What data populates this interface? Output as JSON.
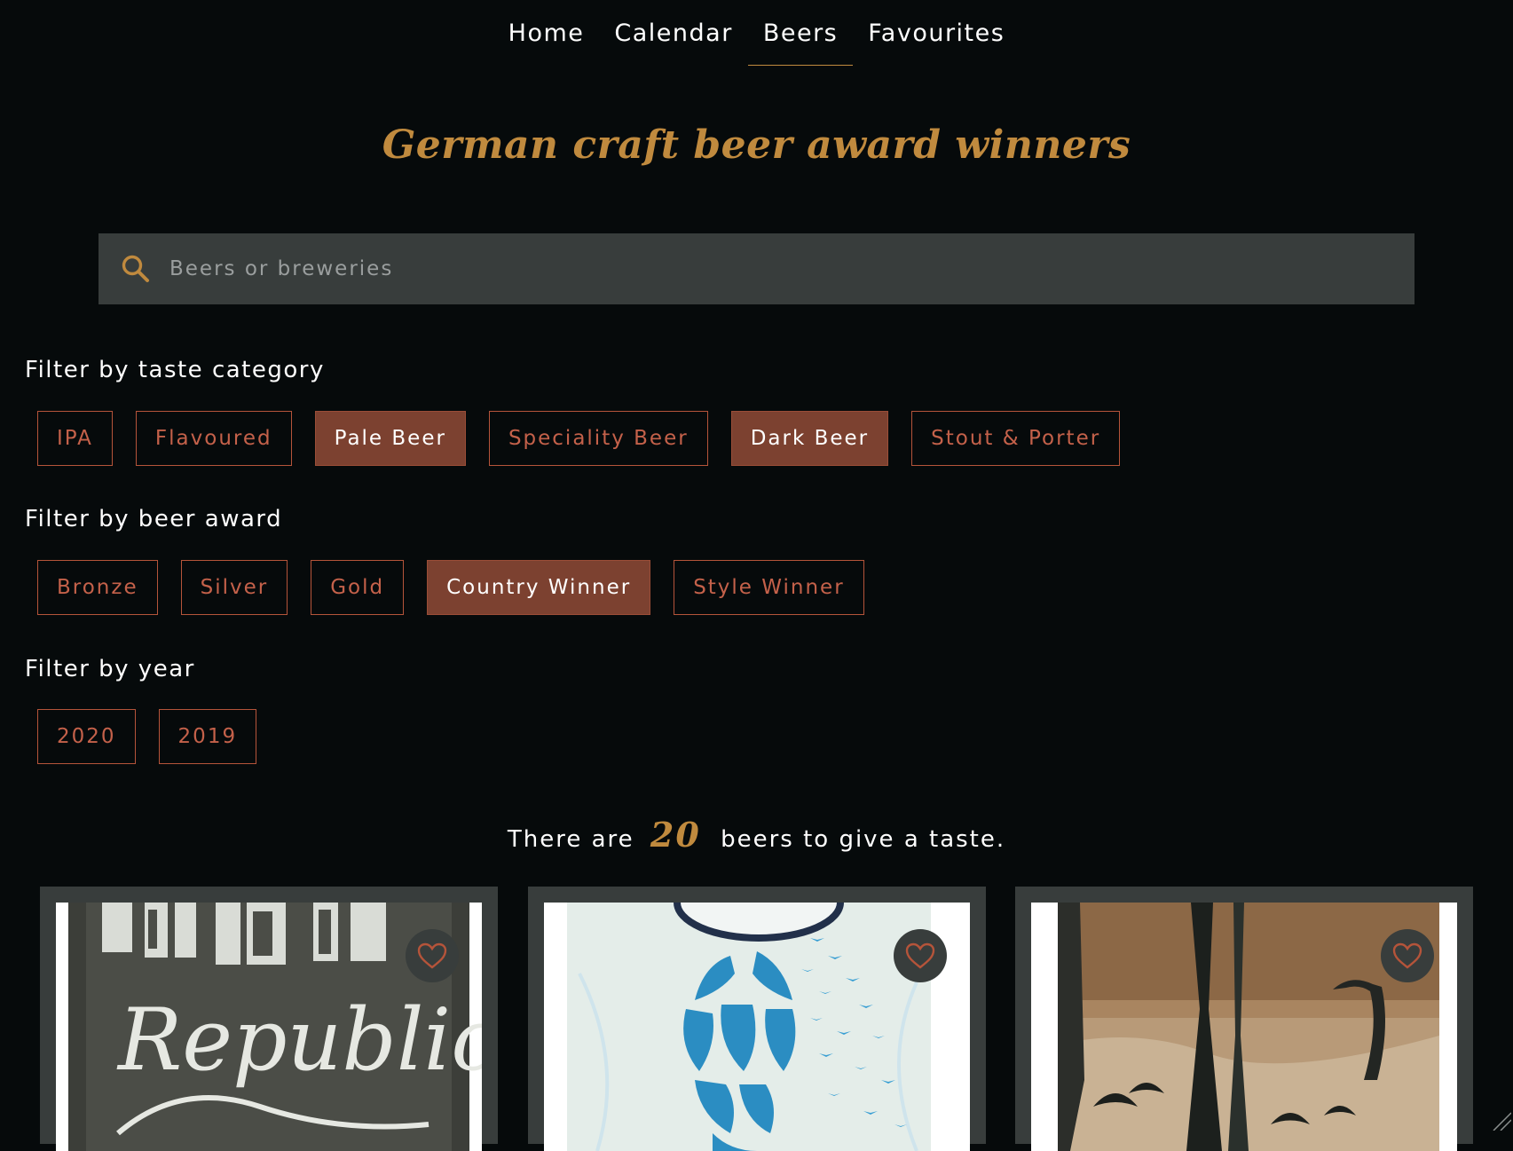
{
  "nav": {
    "items": [
      {
        "label": "Home"
      },
      {
        "label": "Calendar"
      },
      {
        "label": "Beers"
      },
      {
        "label": "Favourites"
      }
    ],
    "active": "Beers"
  },
  "page_title": "German craft beer award winners",
  "search": {
    "placeholder": "Beers or breweries",
    "value": ""
  },
  "filters": {
    "taste": {
      "heading": "Filter by taste category",
      "options": [
        {
          "label": "IPA",
          "selected": false
        },
        {
          "label": "Flavoured",
          "selected": false
        },
        {
          "label": "Pale Beer",
          "selected": true
        },
        {
          "label": "Speciality Beer",
          "selected": false
        },
        {
          "label": "Dark Beer",
          "selected": true
        },
        {
          "label": "Stout & Porter",
          "selected": false
        }
      ]
    },
    "award": {
      "heading": "Filter by beer award",
      "options": [
        {
          "label": "Bronze",
          "selected": false
        },
        {
          "label": "Silver",
          "selected": false
        },
        {
          "label": "Gold",
          "selected": false
        },
        {
          "label": "Country Winner",
          "selected": true
        },
        {
          "label": "Style Winner",
          "selected": false
        }
      ]
    },
    "year": {
      "heading": "Filter by year",
      "options": [
        {
          "label": "2020",
          "selected": false
        },
        {
          "label": "2019",
          "selected": false
        }
      ]
    }
  },
  "results": {
    "prefix": "There are",
    "count": "20",
    "suffix": "beers to give a taste."
  },
  "cards": [
    {
      "image": "brew-republic-can",
      "logo_text": "Republic",
      "favourite_icon": "heart-icon"
    },
    {
      "image": "hop-birds-can",
      "favourite_icon": "heart-icon"
    },
    {
      "image": "crane-bird-label-can",
      "favourite_icon": "heart-icon"
    }
  ],
  "colors": {
    "background": "#060a0b",
    "accent_gold": "#c08a3e",
    "chip_border": "#b5543a",
    "chip_selected": "#7c4130",
    "panel": "#383d3c"
  }
}
